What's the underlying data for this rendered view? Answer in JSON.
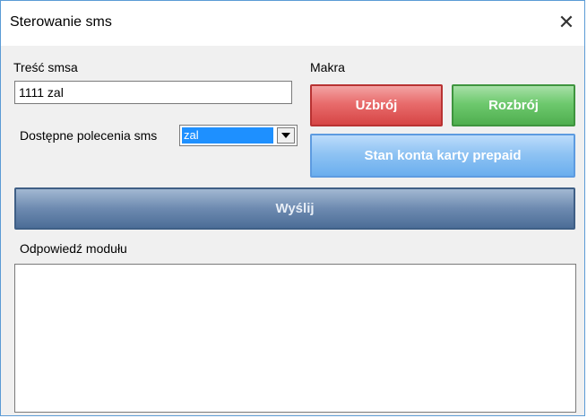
{
  "window": {
    "title": "Sterowanie sms",
    "close_symbol": "✕"
  },
  "sms": {
    "content_label": "Treść smsa",
    "content_value": "1111 zal"
  },
  "commands": {
    "label": "Dostępne polecenia sms",
    "selected": "zal"
  },
  "macros": {
    "label": "Makra",
    "arm_label": "Uzbrój",
    "disarm_label": "Rozbrój",
    "balance_label": "Stan konta karty prepaid"
  },
  "send": {
    "label": "Wyślij"
  },
  "response": {
    "label": "Odpowiedź modułu",
    "value": ""
  },
  "colors": {
    "arm": "#e06464",
    "disarm": "#5cbb5c",
    "balance": "#84bdf2",
    "send": "#5f7ea6"
  }
}
